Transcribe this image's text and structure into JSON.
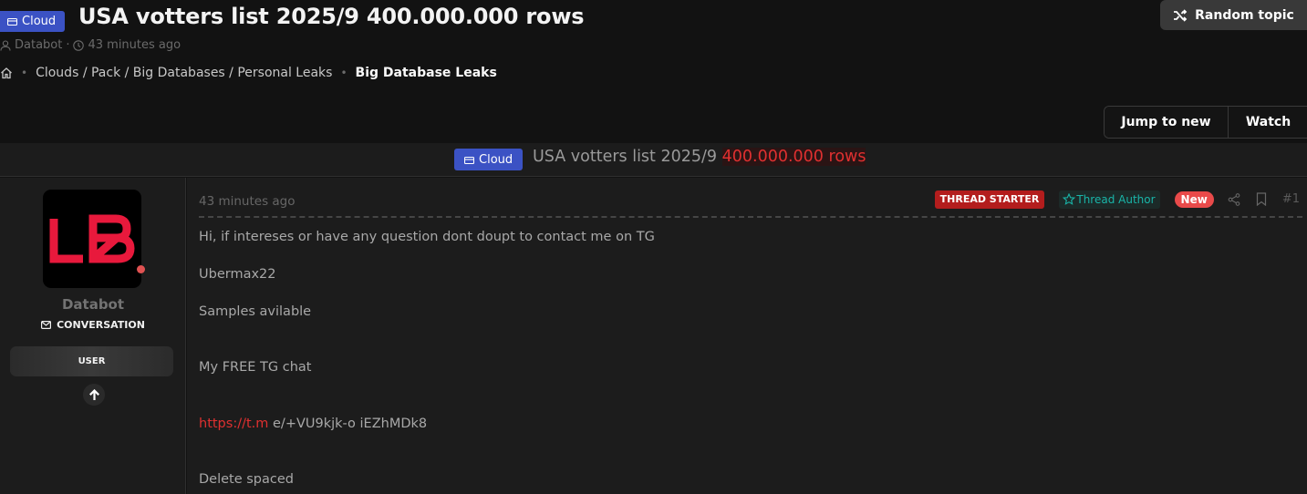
{
  "thread": {
    "prefix": "Cloud",
    "title": "USA votters list 2025/9 400.000.000 rows",
    "author": "Databot",
    "separator": "·",
    "posted_ago": "43 minutes ago",
    "random_topic_label": "Random topic"
  },
  "breadcrumb": {
    "sep": "•",
    "items": [
      "Clouds / Pack / Big Databases / Personal Leaks",
      "Big Database Leaks"
    ]
  },
  "actions": {
    "jump_to_new": "Jump to new",
    "watch": "Watch"
  },
  "title_bar": {
    "prefix": "Cloud",
    "title_main": "USA votters list 2025/9 ",
    "title_highlight": "400.000.000 rows"
  },
  "user": {
    "name": "Databot",
    "conversation_label": "CONVERSATION",
    "role": "USER"
  },
  "post": {
    "time": "43 minutes ago",
    "badge_starter": "THREAD STARTER",
    "badge_author": "Thread Author",
    "badge_new": "New",
    "number": "#1",
    "lines": {
      "l1": "Hi, if intereses or have any question dont doupt to contact me on TG",
      "l2": "Ubermax22",
      "l3": "Samples avilable",
      "l4": "My FREE TG chat",
      "link_part": "https://t.m",
      "link_rest": " e/+VU9kjk-o iEZhMDk8",
      "l6": "Delete spaced"
    }
  },
  "colors": {
    "background": "#121212",
    "panel": "#1c1c1c",
    "prefix_blue": "#3b52c4",
    "accent_red": "#e03030",
    "teal": "#19b5a8"
  },
  "icons": {
    "prefix": "folder-icon",
    "meta_user": "user-icon",
    "meta_time": "clock-icon",
    "home": "home-icon",
    "random": "shuffle-icon",
    "conversation": "envelope-icon",
    "up": "arrow-up-icon",
    "author": "star-icon",
    "share": "share-icon",
    "bookmark": "bookmark-icon"
  }
}
